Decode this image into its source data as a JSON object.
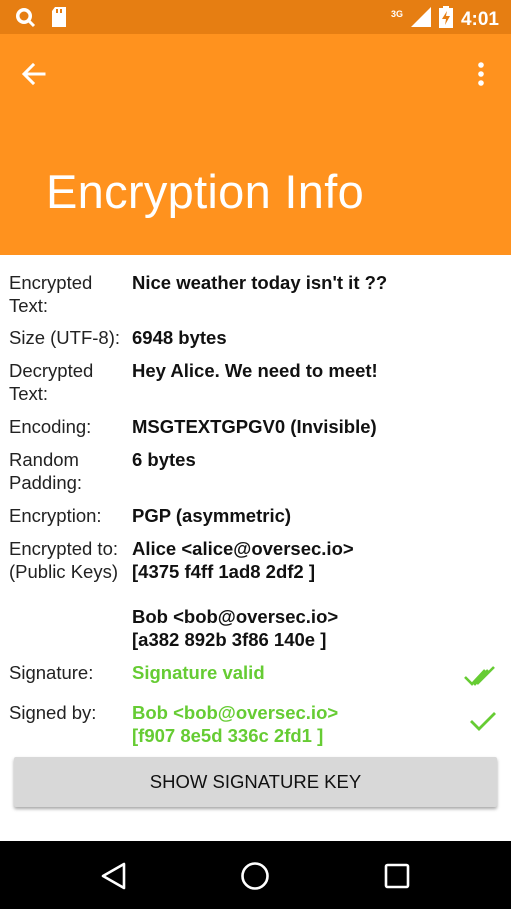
{
  "status_bar": {
    "network": "3G",
    "time": "4:01",
    "icons": [
      "search-status-icon",
      "sd-card-icon",
      "signal-icon",
      "battery-charging-icon"
    ]
  },
  "app_bar": {
    "title": "Encryption Info",
    "back_icon": "arrow-back-icon",
    "menu_icon": "more-vert-icon"
  },
  "info": {
    "encrypted_text": {
      "label": "Encrypted Text:",
      "value": "Nice weather today isn't it ??"
    },
    "size": {
      "label": "Size (UTF-8):",
      "value": "6948 bytes"
    },
    "decrypted_text": {
      "label": "Decrypted Text:",
      "value": "Hey Alice. We need to meet!"
    },
    "encoding": {
      "label": "Encoding:",
      "value": "MSGTEXTGPGV0 (Invisible)"
    },
    "padding": {
      "label": "Random Padding:",
      "value": "6 bytes"
    },
    "encryption": {
      "label": "Encryption:",
      "value": "PGP (asymmetric)"
    },
    "encrypted_to": {
      "label_line1": "Encrypted to:",
      "label_line2": "(Public Keys)",
      "keys": [
        {
          "name": "Alice <alice@oversec.io>",
          "fingerprint": "[4375 f4ff 1ad8 2df2 ]"
        },
        {
          "name": "Bob <bob@oversec.io>",
          "fingerprint": "[a382 892b 3f86 140e ]"
        }
      ]
    },
    "signature": {
      "label": "Signature:",
      "value": "Signature valid",
      "icon": "double-check-icon",
      "color": "#66cc33"
    },
    "signed_by": {
      "label": "Signed by:",
      "name": "Bob <bob@oversec.io>",
      "fingerprint": "[f907 8e5d 336c 2fd1 ]",
      "icon": "check-icon",
      "color": "#66cc33"
    }
  },
  "actions": {
    "show_signature_key": "SHOW SIGNATURE KEY"
  },
  "colors": {
    "status_bar": "#e67e12",
    "app_bar": "#ff921e",
    "valid": "#66cc33"
  },
  "nav_bar": {
    "buttons": [
      "back-triangle-icon",
      "home-circle-icon",
      "recents-square-icon"
    ]
  }
}
